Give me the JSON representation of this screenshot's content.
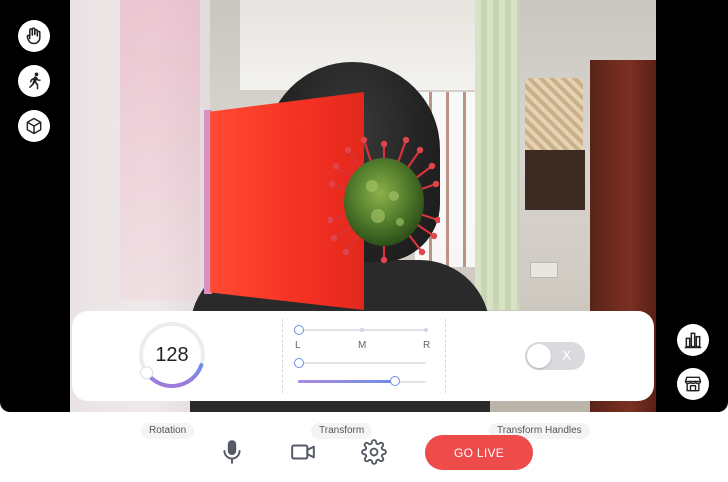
{
  "controls": {
    "rotation": {
      "label": "Rotation",
      "value": "128",
      "dial_fraction": 0.35
    },
    "transform": {
      "label": "Transform",
      "left_label": "L",
      "mid_label": "M",
      "right_label": "R",
      "slider1_value": 0.0,
      "slider2_value": 0.0,
      "slider3_value": 0.76
    },
    "transform_handles": {
      "label": "Transform Handles",
      "toggle_on": false,
      "toggle_symbol": "X"
    }
  },
  "bottom_bar": {
    "go_live_label": "GO LIVE"
  },
  "icons": {
    "left_toolbar": [
      "hand-gesture-icon",
      "runner-icon",
      "3d-box-icon"
    ],
    "right_toolbar": [
      "bar-chart-icon",
      "store-icon"
    ],
    "bottom_bar": [
      "microphone-icon",
      "video-camera-icon",
      "settings-gear-icon"
    ]
  },
  "colors": {
    "accent": "#6e8fe6",
    "go_live": "#ee4b4b",
    "ar_panel": "#f53123",
    "toggle_off": "#d9d9de"
  }
}
